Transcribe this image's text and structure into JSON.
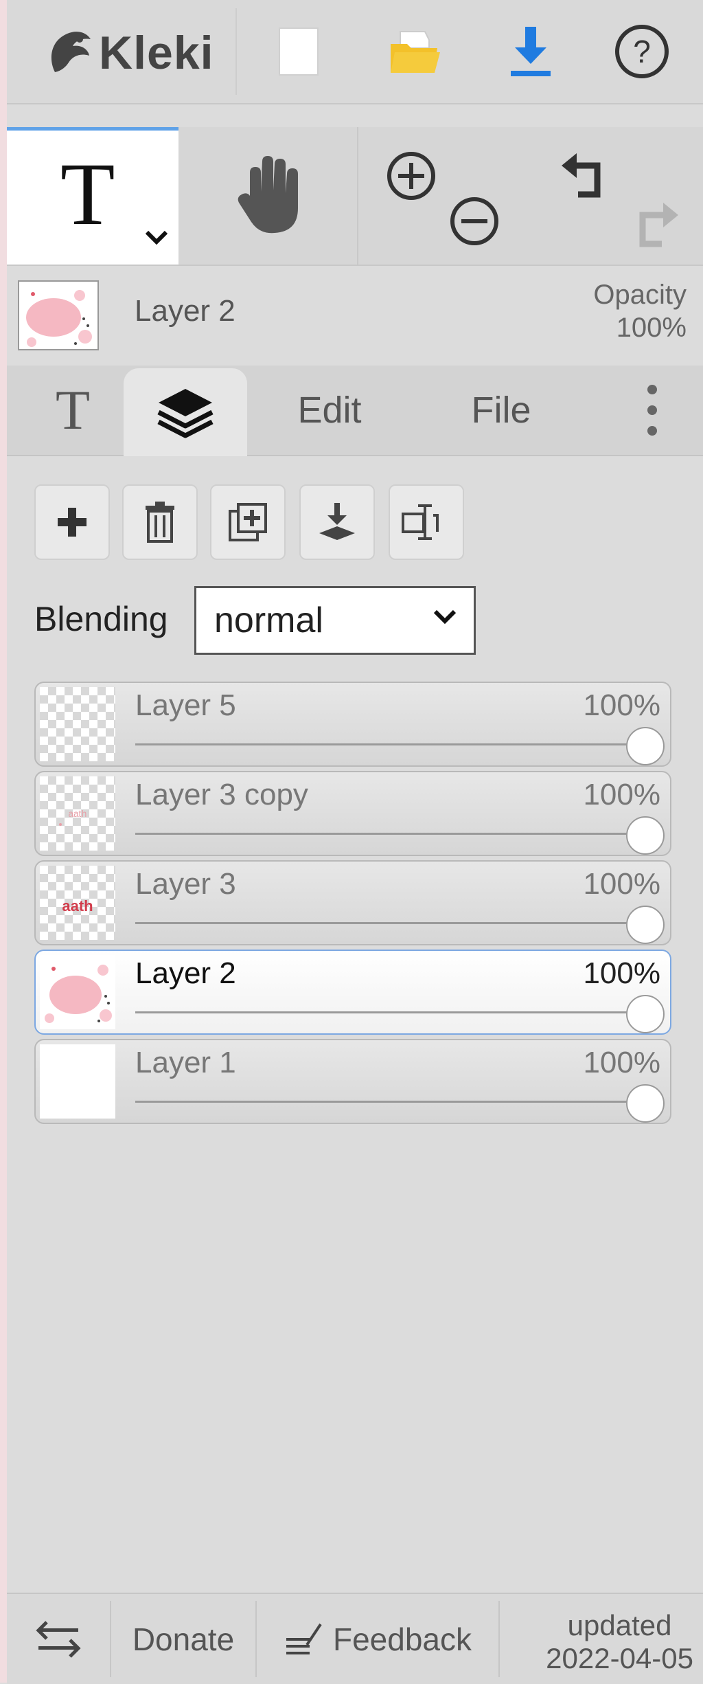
{
  "header": {
    "logo_text": "Kleki",
    "icons": [
      "new-image-icon",
      "open-folder-icon",
      "download-icon",
      "help-icon"
    ]
  },
  "tools": {
    "text_tool_glyph": "T",
    "icons": [
      "text-tool",
      "hand-tool",
      "zoom-in-icon",
      "zoom-out-icon",
      "undo-icon",
      "redo-icon"
    ]
  },
  "layer_info": {
    "name": "Layer 2",
    "opacity_label": "Opacity",
    "opacity_value": "100%"
  },
  "tabs": {
    "tool_tab_glyph": "T",
    "edit": "Edit",
    "file": "File",
    "active": "layers"
  },
  "layer_controls": {
    "blending_label": "Blending",
    "blending_value": "normal",
    "buttons": [
      "add-layer",
      "delete-layer",
      "duplicate-layer",
      "merge-down",
      "rename-layer"
    ]
  },
  "layers": [
    {
      "name": "Layer 5",
      "opacity": "100%",
      "opacity_value": 1.0,
      "active": false
    },
    {
      "name": "Layer 3 copy",
      "opacity": "100%",
      "opacity_value": 1.0,
      "active": false
    },
    {
      "name": "Layer 3",
      "opacity": "100%",
      "opacity_value": 1.0,
      "active": false
    },
    {
      "name": "Layer 2",
      "opacity": "100%",
      "opacity_value": 1.0,
      "active": true
    },
    {
      "name": "Layer 1",
      "opacity": "100%",
      "opacity_value": 1.0,
      "active": false
    }
  ],
  "footer": {
    "donate": "Donate",
    "feedback": "Feedback",
    "updated_label": "updated",
    "updated_date": "2022-04-05"
  },
  "colors": {
    "accent_blue": "#1f7be0",
    "folder_yellow": "#f3c12a",
    "active_tab_blue": "#5fa2e8"
  }
}
